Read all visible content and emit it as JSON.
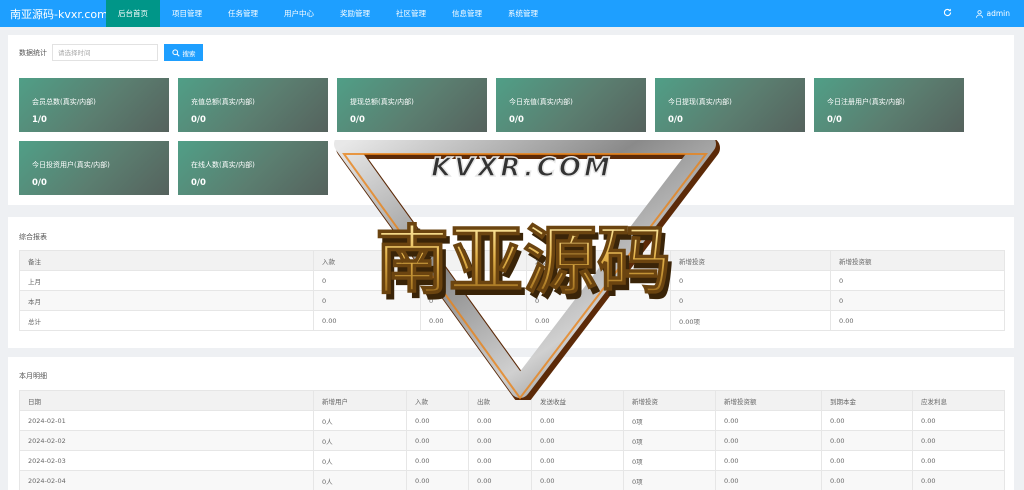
{
  "header": {
    "logo": "南亚源码-kvxr.com",
    "nav": [
      {
        "label": "后台首页",
        "active": true,
        "caret": false
      },
      {
        "label": "项目管理",
        "active": false,
        "caret": true
      },
      {
        "label": "任务管理",
        "active": false,
        "caret": true
      },
      {
        "label": "用户中心",
        "active": false,
        "caret": true
      },
      {
        "label": "奖励管理",
        "active": false,
        "caret": true
      },
      {
        "label": "社区管理",
        "active": false,
        "caret": true
      },
      {
        "label": "信息管理",
        "active": false,
        "caret": true
      },
      {
        "label": "系统管理",
        "active": false,
        "caret": true
      }
    ],
    "refresh_icon": "refresh-icon",
    "user": "admin",
    "user_icon": "user-icon",
    "accent": "#1e9fff",
    "active_bg": "#009688"
  },
  "stats": {
    "label": "数据统计",
    "date_placeholder": "请选择时间",
    "search_label": "搜索",
    "search_icon": "search-icon",
    "cards": [
      {
        "title": "会员总数(真实/内部)",
        "value": "1/0"
      },
      {
        "title": "充值总额(真实/内部)",
        "value": "0/0"
      },
      {
        "title": "提现总额(真实/内部)",
        "value": "0/0"
      },
      {
        "title": "今日充值(真实/内部)",
        "value": "0/0"
      },
      {
        "title": "今日提现(真实/内部)",
        "value": "0/0"
      },
      {
        "title": "今日注册用户(真实/内部)",
        "value": "0/0"
      },
      {
        "title": "今日投资用户(真实/内部)",
        "value": "0/0"
      },
      {
        "title": "在线人数(真实/内部)",
        "value": "0/0"
      }
    ]
  },
  "report": {
    "title": "综合报表",
    "headers": [
      "备注",
      "入款",
      "出款",
      "发送收益",
      "新增投资",
      "新增投资额"
    ],
    "rows": [
      [
        "上月",
        "0",
        "0",
        "0",
        "0",
        "0"
      ],
      [
        "本月",
        "0",
        "0",
        "0",
        "0",
        "0"
      ],
      [
        "总计",
        "0.00",
        "0.00",
        "0.00",
        "0.00项",
        "0.00"
      ]
    ]
  },
  "monthly": {
    "title": "本月明细",
    "headers": [
      "日期",
      "新增用户",
      "入款",
      "出款",
      "发送收益",
      "新增投资",
      "新增投资额",
      "到期本金",
      "应发利息"
    ],
    "rows": [
      [
        "2024-02-01",
        "0人",
        "0.00",
        "0.00",
        "0.00",
        "0项",
        "0.00",
        "0.00",
        "0.00"
      ],
      [
        "2024-02-02",
        "0人",
        "0.00",
        "0.00",
        "0.00",
        "0项",
        "0.00",
        "0.00",
        "0.00"
      ],
      [
        "2024-02-03",
        "0人",
        "0.00",
        "0.00",
        "0.00",
        "0项",
        "0.00",
        "0.00",
        "0.00"
      ],
      [
        "2024-02-04",
        "0人",
        "0.00",
        "0.00",
        "0.00",
        "0项",
        "0.00",
        "0.00",
        "0.00"
      ]
    ]
  },
  "watermark": {
    "top_text": "KVXR.COM",
    "main_text": "南亚源码"
  }
}
